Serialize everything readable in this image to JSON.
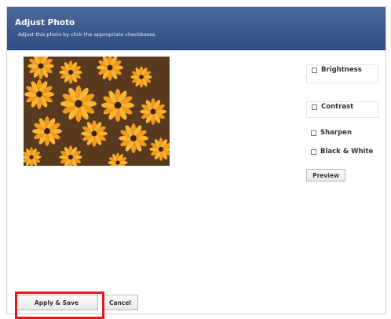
{
  "dialog": {
    "title": "Adjust Photo",
    "subtitle": "Adjust this photo by click the appropriate checkboxes."
  },
  "photo": {
    "description_icon": "flower-photo"
  },
  "options": {
    "brightness": "Brightness",
    "contrast": "Contrast",
    "sharpen": "Sharpen",
    "black_white": "Black & White"
  },
  "buttons": {
    "preview": "Preview",
    "apply_save": "Apply & Save",
    "cancel": "Cancel"
  },
  "colors": {
    "titlebar": "#3c5a8e",
    "highlight": "#e01b1b"
  }
}
